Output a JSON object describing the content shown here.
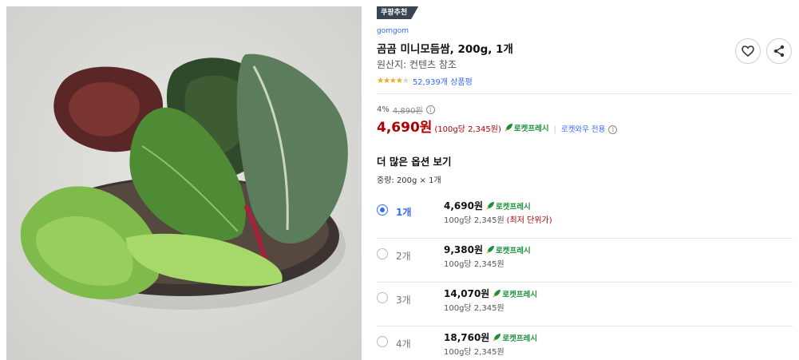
{
  "product_image": {
    "alt": "mixed salad greens on a dark plate"
  },
  "badge": "쿠팡추천",
  "brand": "gomgom",
  "title": "곰곰 미니모듬쌈, 200g, 1개",
  "origin": "원산지: 컨텐츠 참조",
  "rating": {
    "stars": 4.5,
    "review_count": "52,939개 상품평"
  },
  "actions": {
    "wish_icon": "heart-icon",
    "share_icon": "share-icon"
  },
  "price": {
    "discount_rate": "4%",
    "original_price": "4,890원",
    "sale_price": "4,690원",
    "unit_price": "(100g당 2,345원)",
    "rocket_label": "로켓프레시",
    "wow_label": "로켓와우 전용"
  },
  "options": {
    "section_title": "더 많은 옵션 보기",
    "weight_label": "중량: 200g × 1개",
    "items": [
      {
        "qty": "1개",
        "price": "4,690원",
        "rocket": "로켓프레시",
        "unit_price": "100g당 2,345원",
        "note": "(최저 단위가)",
        "selected": true
      },
      {
        "qty": "2개",
        "price": "9,380원",
        "rocket": "로켓프레시",
        "unit_price": "100g당 2,345원",
        "note": "",
        "selected": false
      },
      {
        "qty": "3개",
        "price": "14,070원",
        "rocket": "로켓프레시",
        "unit_price": "100g당 2,345원",
        "note": "",
        "selected": false
      },
      {
        "qty": "4개",
        "price": "18,760원",
        "rocket": "로켓프레시",
        "unit_price": "100g당 2,345원",
        "note": "",
        "selected": false
      }
    ]
  },
  "colors": {
    "accent_blue": "#346aff",
    "price_red": "#ae0000",
    "rocket_green": "#1d8f3a",
    "star": "#f5a623"
  }
}
